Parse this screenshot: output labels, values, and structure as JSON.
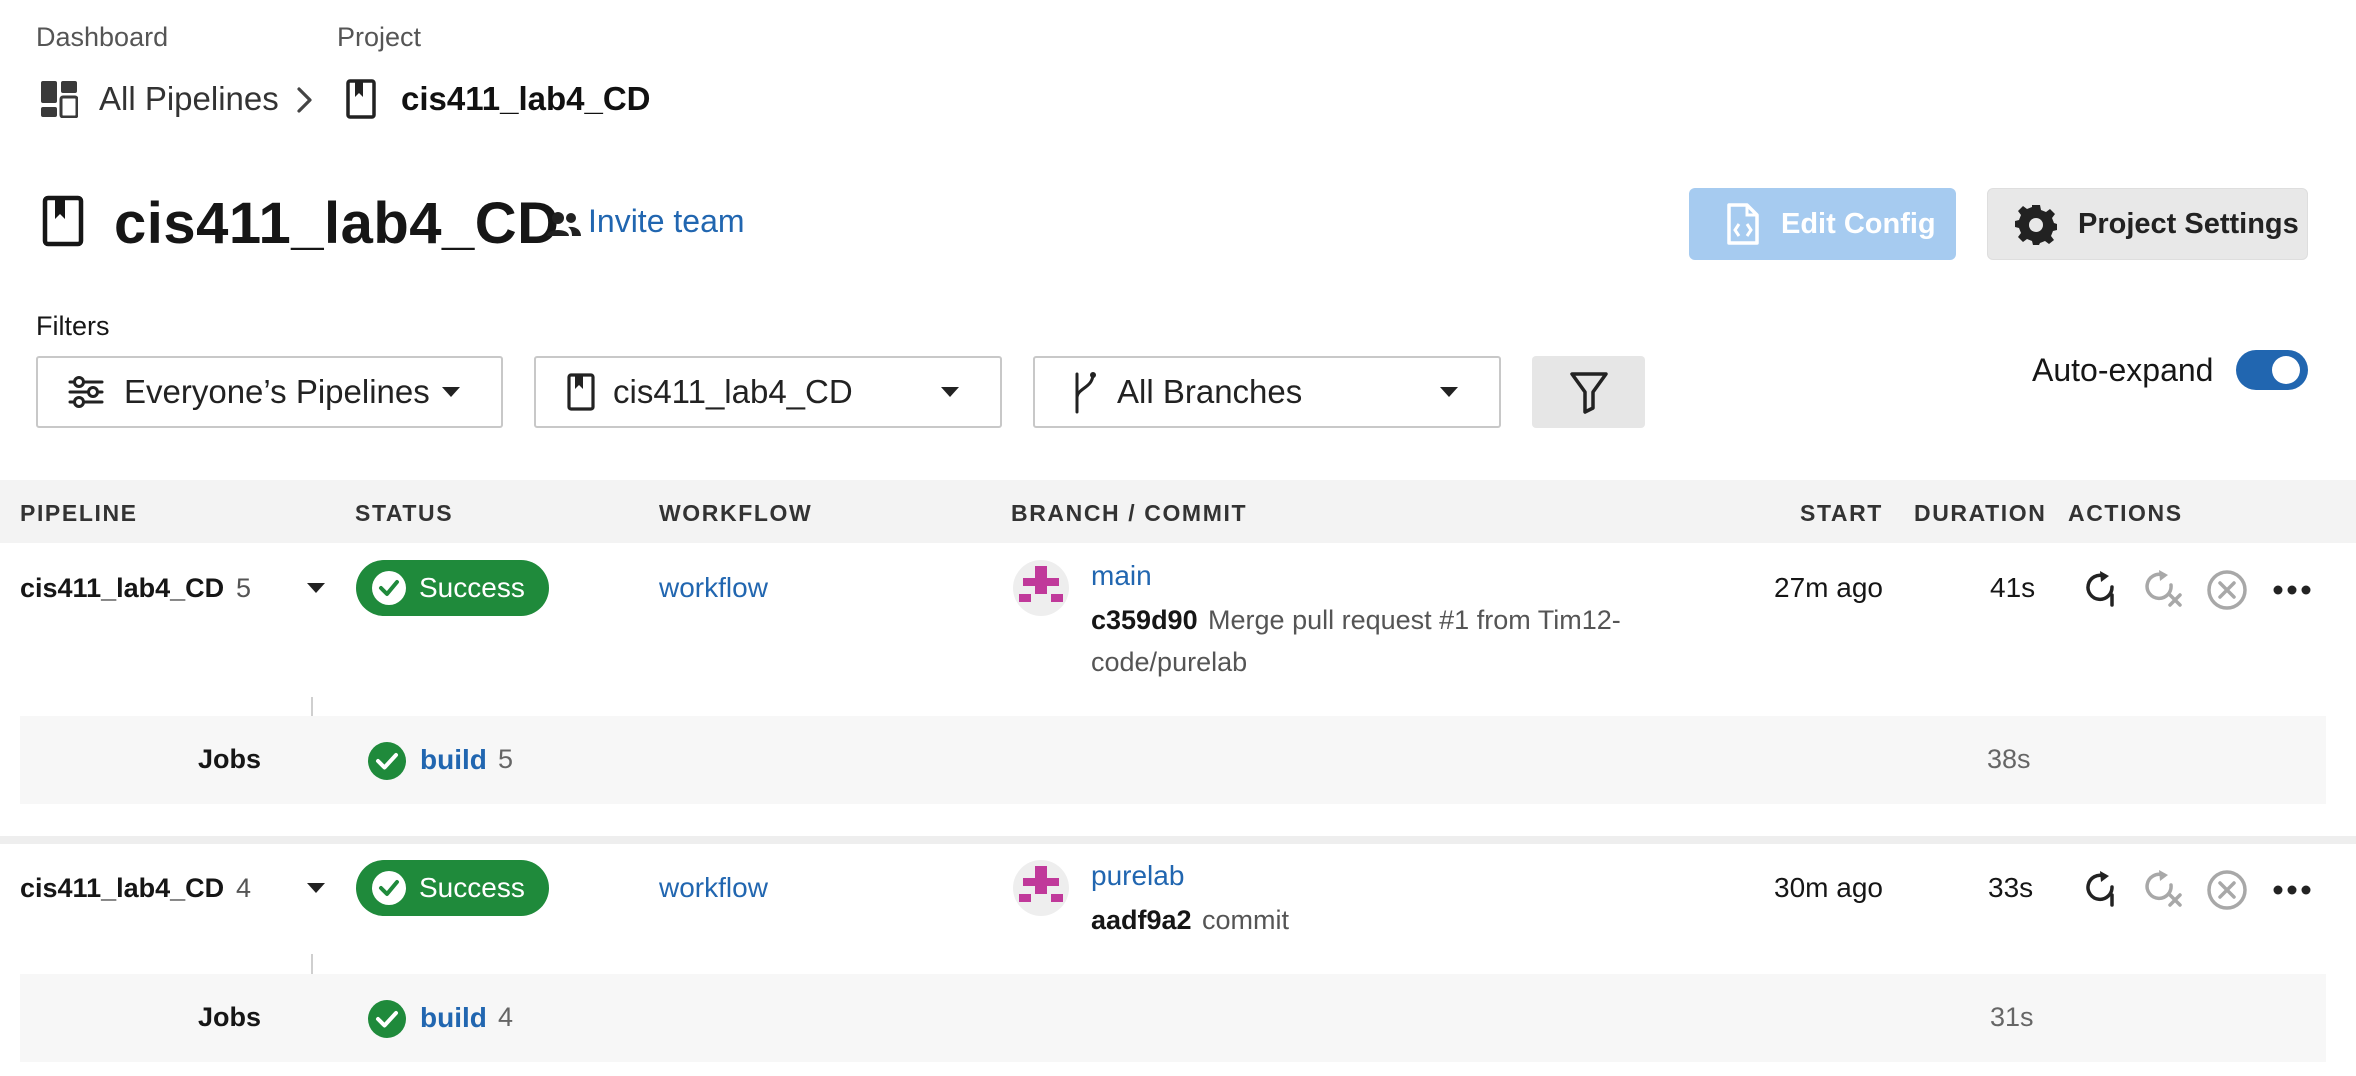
{
  "breadcrumb": {
    "dashboard_label": "Dashboard",
    "project_label": "Project",
    "all_pipelines": "All Pipelines",
    "project_name": "cis411_lab4_CD"
  },
  "header": {
    "title": "cis411_lab4_CD",
    "invite_team": "Invite team",
    "edit_config": "Edit Config",
    "project_settings": "Project Settings"
  },
  "filters": {
    "label": "Filters",
    "pipelines_select": "Everyone’s Pipelines",
    "project_select": "cis411_lab4_CD",
    "branches_select": "All Branches",
    "auto_expand_label": "Auto-expand",
    "auto_expand_on": true
  },
  "table": {
    "headers": {
      "pipeline": "PIPELINE",
      "status": "STATUS",
      "workflow": "WORKFLOW",
      "branch_commit": "BRANCH / COMMIT",
      "start": "START",
      "duration": "DURATION",
      "actions": "ACTIONS"
    },
    "rows": [
      {
        "pipeline": "cis411_lab4_CD",
        "number": "5",
        "status": "Success",
        "workflow": "workflow",
        "branch": "main",
        "commit_sha": "c359d90",
        "commit_msg_line1": "Merge pull request #1 from Tim12-",
        "commit_msg_line2": "code/purelab",
        "start": "27m ago",
        "duration": "41s",
        "jobs_label": "Jobs",
        "job_name": "build",
        "job_number": "5",
        "job_duration": "38s"
      },
      {
        "pipeline": "cis411_lab4_CD",
        "number": "4",
        "status": "Success",
        "workflow": "workflow",
        "branch": "purelab",
        "commit_sha": "aadf9a2",
        "commit_msg_line1": "commit",
        "start": "30m ago",
        "duration": "33s",
        "jobs_label": "Jobs",
        "job_name": "build",
        "job_number": "4",
        "job_duration": "31s"
      }
    ]
  },
  "colors": {
    "accent": "#2166b0",
    "success": "#1f8a3b",
    "edit_config_bg": "#a6cbf0",
    "avatar": "#c0399a"
  },
  "icons": {
    "dashboard": "dashboard-grid-icon",
    "chevron": "chevron-right-icon",
    "project": "bookmark-project-icon",
    "team": "people-icon",
    "config": "config-file-icon",
    "settings": "gear-icon",
    "filter": "funnel-icon",
    "branch": "git-branch-icon",
    "rerun": "rerun-icon",
    "rerun_failed": "rerun-failed-icon",
    "cancel": "cancel-icon",
    "more": "more-dots-icon"
  }
}
